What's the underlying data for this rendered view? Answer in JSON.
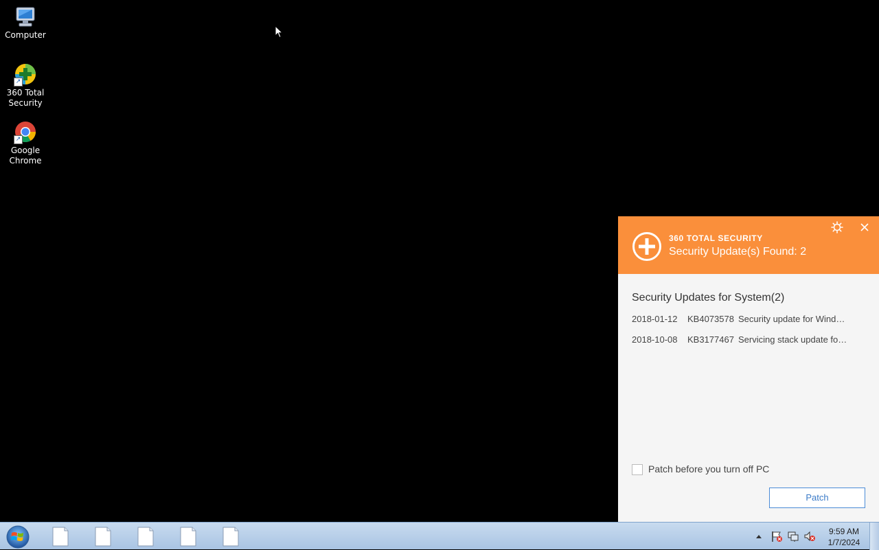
{
  "desktop": {
    "icons": [
      {
        "label": "Computer",
        "icon": "computer-icon"
      },
      {
        "label": "360 Total Security",
        "label_line1": "360 Total",
        "label_line2": "Security",
        "icon": "360-total-security-icon"
      },
      {
        "label": "Google Chrome",
        "label_line1": "Google",
        "label_line2": "Chrome",
        "icon": "chrome-icon"
      }
    ]
  },
  "popup": {
    "brand": "360 TOTAL SECURITY",
    "title": "Security Update(s) Found: 2",
    "section_title": "Security Updates for System(2)",
    "updates": [
      {
        "date": "2018-01-12",
        "kb": "KB4073578",
        "description": "Security update for Windo..."
      },
      {
        "date": "2018-10-08",
        "kb": "KB3177467",
        "description": "Servicing stack update for ..."
      }
    ],
    "checkbox_label": "Patch before you turn off PC",
    "checkbox_checked": false,
    "patch_button_label": "Patch",
    "header_color": "#fa8f3b",
    "button_color": "#3b7bc8"
  },
  "taskbar": {
    "start_icon": "windows-start-icon",
    "task_buttons": [
      "document-icon",
      "document-icon",
      "document-icon",
      "document-icon",
      "document-icon"
    ],
    "tray_icons": [
      "show-hidden-icons-arrow",
      "action-center-flag-icon",
      "network-icon",
      "volume-muted-icon"
    ],
    "clock_time": "9:59 AM",
    "clock_date": "1/7/2024"
  }
}
